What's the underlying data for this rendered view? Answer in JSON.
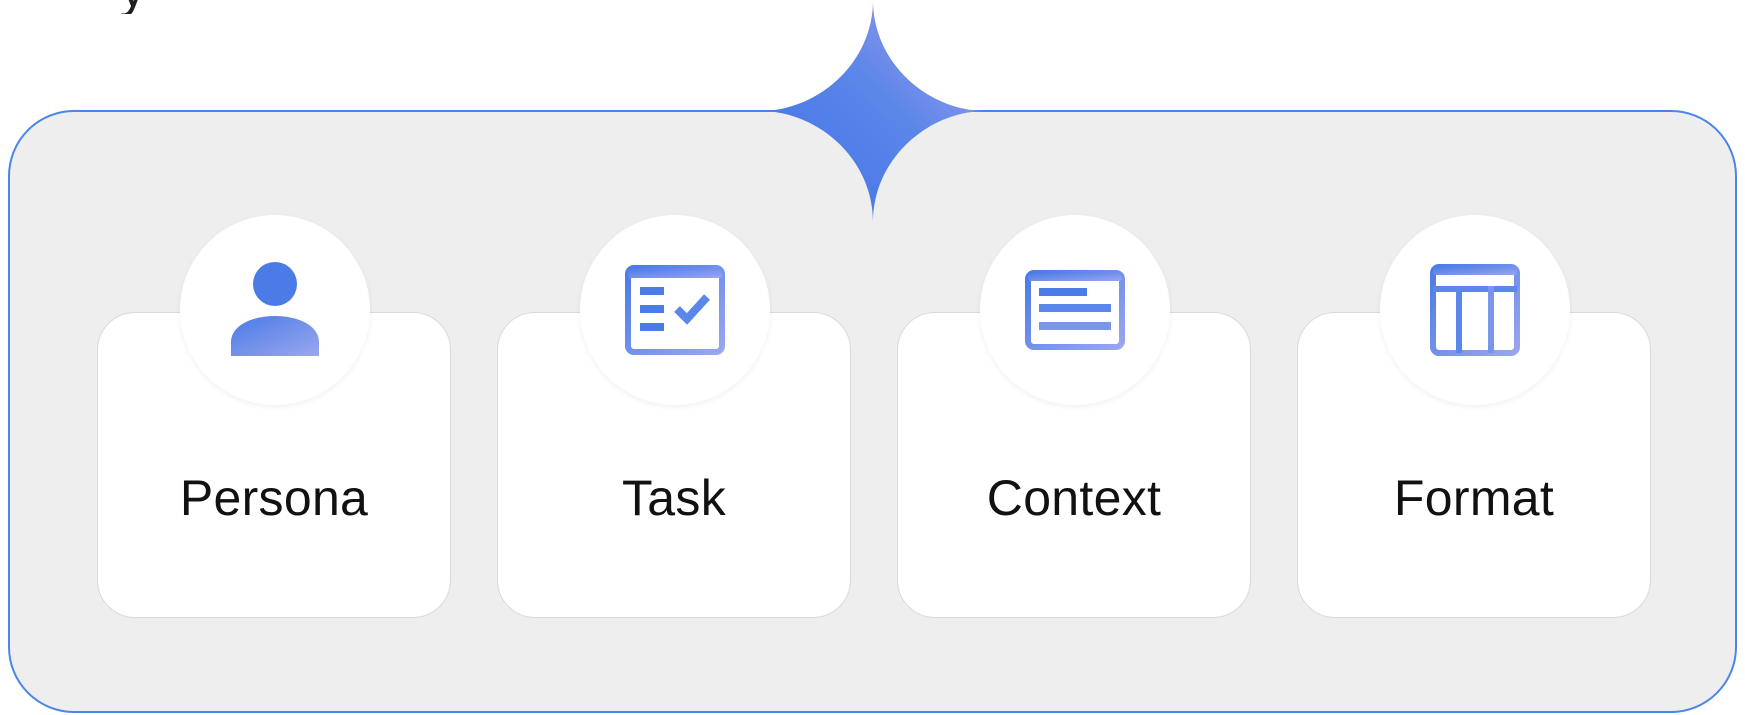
{
  "diagram": {
    "headline": "y",
    "components": [
      {
        "id": "persona",
        "label": "Persona",
        "icon": "person-icon"
      },
      {
        "id": "task",
        "label": "Task",
        "icon": "task-checklist-icon"
      },
      {
        "id": "context",
        "label": "Context",
        "icon": "document-lines-icon"
      },
      {
        "id": "format",
        "label": "Format",
        "icon": "table-layout-icon"
      }
    ]
  },
  "colors": {
    "panel_fill": "#eeeeee",
    "panel_border": "#4a86e8",
    "icon_blue": "#4a7be6",
    "icon_lavender": "#9aa6ee",
    "sparkle_blue": "#3e6fe4",
    "sparkle_violet": "#a79ceb"
  }
}
